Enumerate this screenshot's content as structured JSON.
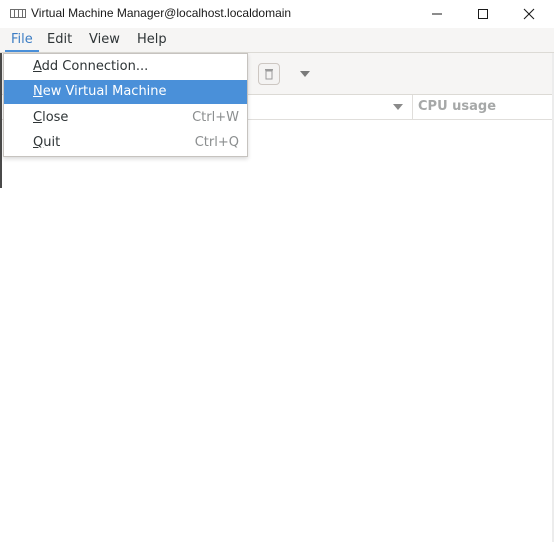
{
  "window": {
    "title": "Virtual Machine Manager@localhost.localdomain",
    "app_icon": "virt-manager-icon",
    "controls": [
      "minimize-icon",
      "maximize-icon",
      "close-icon"
    ]
  },
  "menubar": {
    "items": [
      {
        "label": "File",
        "active": true
      },
      {
        "label": "Edit"
      },
      {
        "label": "View"
      },
      {
        "label": "Help"
      }
    ]
  },
  "file_menu": {
    "items": [
      {
        "mnemonic": "A",
        "rest": "dd Connection...",
        "accel": ""
      },
      {
        "mnemonic": "N",
        "rest": "ew Virtual Machine",
        "accel": "",
        "highlighted": true
      },
      {
        "mnemonic": "C",
        "rest": "lose",
        "accel": "Ctrl+W"
      },
      {
        "mnemonic": "Q",
        "rest": "uit",
        "accel": "Ctrl+Q"
      }
    ]
  },
  "toolbar": {
    "icons": [
      "delete-icon",
      "chevron-down-icon"
    ]
  },
  "list_header": {
    "columns": [
      {
        "label": ""
      },
      {
        "label": "CPU usage"
      }
    ]
  },
  "colors": {
    "accent": "#4a90d9",
    "menu_active_text": "#3c7dc4",
    "header_text": "#a6a8a8"
  }
}
